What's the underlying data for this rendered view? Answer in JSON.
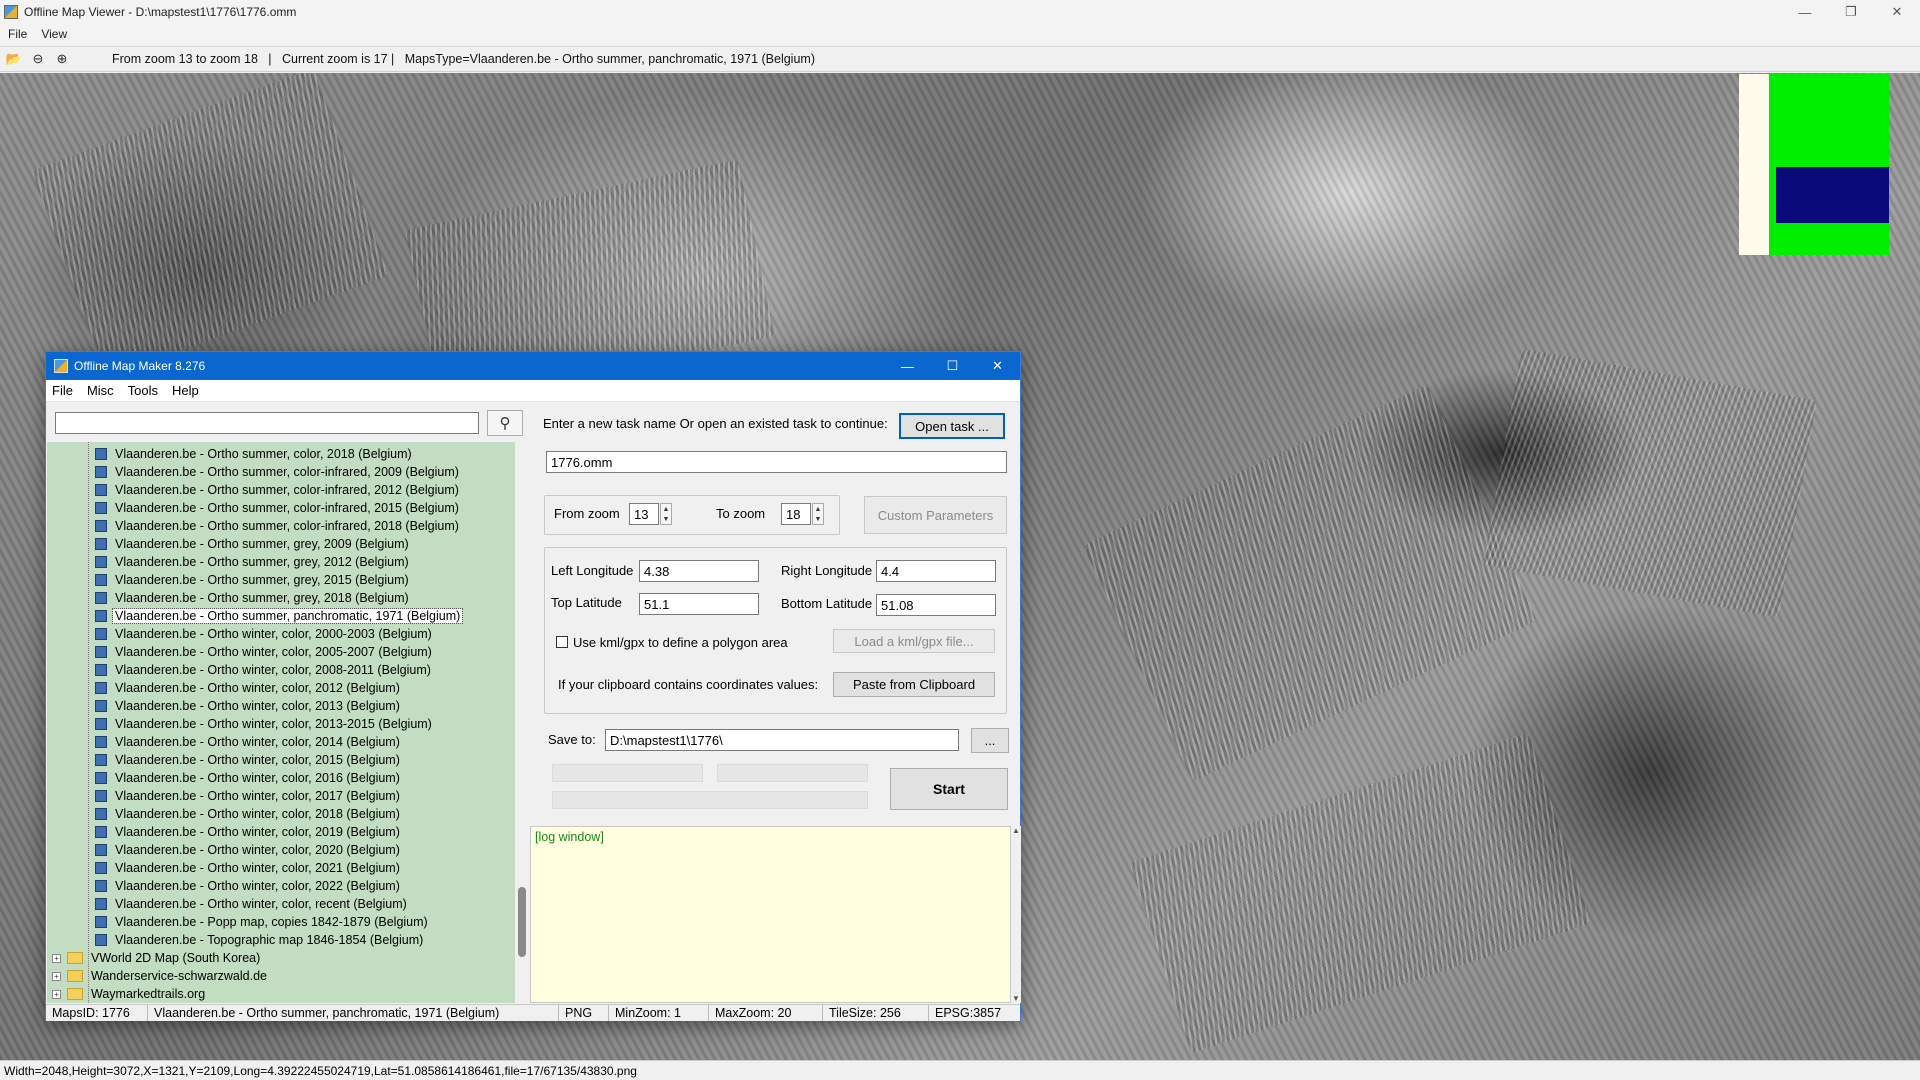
{
  "viewer": {
    "title": "Offline Map Viewer - D:\\mapstest1\\1776\\1776.omm",
    "menu": [
      "File",
      "View"
    ],
    "toolbar_status": "From zoom 13 to zoom 18   |   Current zoom is 17 |   MapsType=Vlaanderen.be - Ortho summer, panchromatic, 1971 (Belgium)",
    "status_bar": "Width=2048,Height=3072,X=1321,Y=2109,Long=4.39222455024719,Lat=51.0858614186461,file=17/67135/43830.png"
  },
  "maker": {
    "title": "Offline Map Maker 8.276",
    "menu": [
      "File",
      "Misc",
      "Tools",
      "Help"
    ],
    "search": {
      "value": ""
    },
    "tree_items": [
      "Vlaanderen.be - Ortho summer, color, 2018 (Belgium)",
      "Vlaanderen.be - Ortho summer, color-infrared, 2009 (Belgium)",
      "Vlaanderen.be - Ortho summer, color-infrared, 2012 (Belgium)",
      "Vlaanderen.be - Ortho summer, color-infrared, 2015 (Belgium)",
      "Vlaanderen.be - Ortho summer, color-infrared, 2018 (Belgium)",
      "Vlaanderen.be - Ortho summer, grey, 2009 (Belgium)",
      "Vlaanderen.be - Ortho summer, grey, 2012 (Belgium)",
      "Vlaanderen.be - Ortho summer, grey, 2015 (Belgium)",
      "Vlaanderen.be - Ortho summer, grey, 2018 (Belgium)",
      "Vlaanderen.be - Ortho summer, panchromatic, 1971 (Belgium)",
      "Vlaanderen.be - Ortho winter, color, 2000-2003 (Belgium)",
      "Vlaanderen.be - Ortho winter, color, 2005-2007 (Belgium)",
      "Vlaanderen.be - Ortho winter, color, 2008-2011 (Belgium)",
      "Vlaanderen.be - Ortho winter, color, 2012 (Belgium)",
      "Vlaanderen.be - Ortho winter, color, 2013 (Belgium)",
      "Vlaanderen.be - Ortho winter, color, 2013-2015 (Belgium)",
      "Vlaanderen.be - Ortho winter, color, 2014 (Belgium)",
      "Vlaanderen.be - Ortho winter, color, 2015 (Belgium)",
      "Vlaanderen.be - Ortho winter, color, 2016 (Belgium)",
      "Vlaanderen.be - Ortho winter, color, 2017 (Belgium)",
      "Vlaanderen.be - Ortho winter, color, 2018 (Belgium)",
      "Vlaanderen.be - Ortho winter, color, 2019 (Belgium)",
      "Vlaanderen.be - Ortho winter, color, 2020 (Belgium)",
      "Vlaanderen.be - Ortho winter, color, 2021 (Belgium)",
      "Vlaanderen.be - Ortho winter, color, 2022 (Belgium)",
      "Vlaanderen.be - Ortho winter, color, recent (Belgium)",
      "Vlaanderen.be - Popp map, copies 1842-1879 (Belgium)",
      "Vlaanderen.be - Topographic map 1846-1854 (Belgium)"
    ],
    "selected_item": "Vlaanderen.be - Ortho summer, panchromatic, 1971 (Belgium)",
    "tree_folders": [
      "VWorld 2D Map (South Korea)",
      "Wanderservice-schwarzwald.de",
      "Waymarkedtrails.org"
    ],
    "task_prompt": "Enter a new task name Or open an existed task to continue:",
    "open_task_label": "Open task ...",
    "task_name": "1776.omm",
    "from_zoom_label": "From zoom",
    "from_zoom": "13",
    "to_zoom_label": "To zoom",
    "to_zoom": "18",
    "custom_params_label": "Custom Parameters",
    "left_lon_label": "Left Longitude",
    "left_lon": "4.38",
    "right_lon_label": "Right Longitude",
    "right_lon": "4.4",
    "top_lat_label": "Top Latitude",
    "top_lat": "51.1",
    "bottom_lat_label": "Bottom Latitude",
    "bottom_lat": "51.08",
    "kml_label": "Use kml/gpx to define a polygon area",
    "load_kml_label": "Load a kml/gpx file...",
    "clipboard_label": "If your clipboard contains coordinates values:",
    "paste_label": "Paste from Clipboard",
    "save_to_label": "Save to:",
    "save_to": "D:\\mapstest1\\1776\\",
    "browse_label": "...",
    "start_label": "Start",
    "log_text": "[log window]",
    "status": {
      "maps_id": "MapsID: 1776",
      "map_name": "Vlaanderen.be - Ortho summer, panchromatic, 1971 (Belgium)",
      "format": "PNG",
      "min_zoom": "MinZoom: 1",
      "max_zoom": "MaxZoom: 20",
      "tile_size": "TileSize: 256",
      "epsg": "EPSG:3857"
    }
  },
  "colors": {
    "accent": "#0a67d0",
    "tree_bg": "#c2ddc1",
    "log_bg": "#ffffe0",
    "minimap_green": "#00ee00",
    "minimap_view": "#0a0a78"
  }
}
